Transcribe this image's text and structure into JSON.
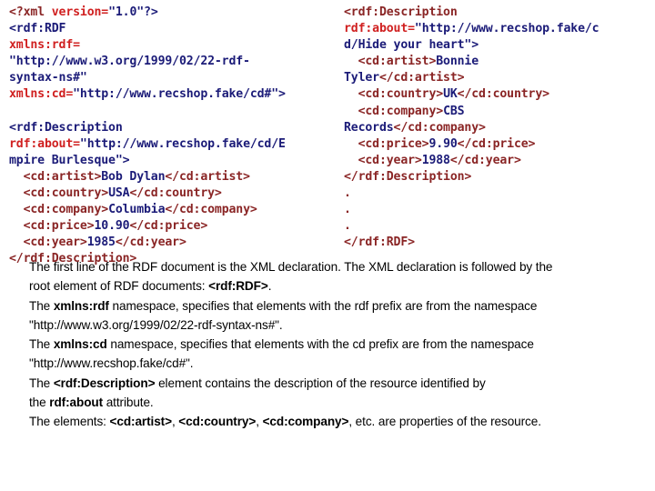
{
  "code": {
    "left_column": [
      {
        "id": "l1",
        "segments": [
          {
            "text": "<?xml ",
            "style": "c-decl"
          },
          {
            "text": "version=",
            "style": "c-attr"
          },
          {
            "text": "\"1.0\"?>",
            "style": "c-ns"
          }
        ]
      },
      {
        "id": "l2",
        "segments": [
          {
            "text": "<rdf:RDF",
            "style": "c-ns"
          }
        ]
      },
      {
        "id": "l3",
        "segments": [
          {
            "text": "xmlns:rdf=",
            "style": "c-attr"
          }
        ]
      },
      {
        "id": "l4",
        "segments": [
          {
            "text": "\"http://www.w3.org/1999/02/22-rdf-",
            "style": "c-ns"
          }
        ]
      },
      {
        "id": "l5",
        "segments": [
          {
            "text": "syntax-ns#\"",
            "style": "c-ns"
          }
        ]
      },
      {
        "id": "l6",
        "segments": [
          {
            "text": "xmlns:cd=",
            "style": "c-attr"
          },
          {
            "text": "\"http://www.recshop.fake/cd#\">",
            "style": "c-ns"
          }
        ]
      },
      {
        "id": "l7",
        "segments": [
          {
            "text": " ",
            "style": "c-ns"
          }
        ]
      },
      {
        "id": "l8",
        "segments": [
          {
            "text": "<rdf:Description",
            "style": "c-ns"
          }
        ]
      },
      {
        "id": "l9",
        "segments": [
          {
            "text": "rdf:about=",
            "style": "c-attr"
          },
          {
            "text": "\"http://www.recshop.fake/cd/E",
            "style": "c-ns"
          }
        ]
      },
      {
        "id": "l10",
        "segments": [
          {
            "text": "mpire Burlesque\">",
            "style": "c-ns"
          }
        ]
      },
      {
        "id": "l11",
        "segments": [
          {
            "text": "  <cd:artist>",
            "style": "c-tag"
          },
          {
            "text": "Bob Dylan",
            "style": "c-text"
          },
          {
            "text": "</cd:artist>",
            "style": "c-tag"
          }
        ]
      },
      {
        "id": "l12",
        "segments": [
          {
            "text": "  <cd:country>",
            "style": "c-tag"
          },
          {
            "text": "USA",
            "style": "c-text"
          },
          {
            "text": "</cd:country>",
            "style": "c-tag"
          }
        ]
      },
      {
        "id": "l13",
        "segments": [
          {
            "text": "  <cd:company>",
            "style": "c-tag"
          },
          {
            "text": "Columbia",
            "style": "c-text"
          },
          {
            "text": "</cd:company>",
            "style": "c-tag"
          }
        ]
      },
      {
        "id": "l14",
        "segments": [
          {
            "text": "  <cd:price>",
            "style": "c-tag"
          },
          {
            "text": "10.90",
            "style": "c-text"
          },
          {
            "text": "</cd:price>",
            "style": "c-tag"
          }
        ]
      },
      {
        "id": "l15",
        "segments": [
          {
            "text": "  <cd:year>",
            "style": "c-tag"
          },
          {
            "text": "1985",
            "style": "c-text"
          },
          {
            "text": "</cd:year>",
            "style": "c-tag"
          }
        ]
      },
      {
        "id": "l16",
        "segments": [
          {
            "text": "</rdf:Description>",
            "style": "c-tag"
          }
        ]
      }
    ],
    "right_column": [
      {
        "id": "r1",
        "segments": [
          {
            "text": "<rdf:Description",
            "style": "c-tag"
          }
        ]
      },
      {
        "id": "r2",
        "segments": [
          {
            "text": "rdf:about=",
            "style": "c-attr"
          },
          {
            "text": "\"http://www.recshop.fake/c",
            "style": "c-ns"
          }
        ]
      },
      {
        "id": "r3",
        "segments": [
          {
            "text": "d/Hide your heart\">",
            "style": "c-ns"
          }
        ]
      },
      {
        "id": "r4",
        "segments": [
          {
            "text": "  <cd:artist>",
            "style": "c-tag"
          },
          {
            "text": "Bonnie",
            "style": "c-text"
          }
        ]
      },
      {
        "id": "r5",
        "segments": [
          {
            "text": "Tyler",
            "style": "c-text"
          },
          {
            "text": "</cd:artist>",
            "style": "c-tag"
          }
        ]
      },
      {
        "id": "r6",
        "segments": [
          {
            "text": "  <cd:country>",
            "style": "c-tag"
          },
          {
            "text": "UK",
            "style": "c-text"
          },
          {
            "text": "</cd:country>",
            "style": "c-tag"
          }
        ]
      },
      {
        "id": "r7",
        "segments": [
          {
            "text": "  <cd:company>",
            "style": "c-tag"
          },
          {
            "text": "CBS",
            "style": "c-text"
          }
        ]
      },
      {
        "id": "r8",
        "segments": [
          {
            "text": "Records",
            "style": "c-text"
          },
          {
            "text": "</cd:company>",
            "style": "c-tag"
          }
        ]
      },
      {
        "id": "r9",
        "segments": [
          {
            "text": "  <cd:price>",
            "style": "c-tag"
          },
          {
            "text": "9.90",
            "style": "c-text"
          },
          {
            "text": "</cd:price>",
            "style": "c-tag"
          }
        ]
      },
      {
        "id": "r10",
        "segments": [
          {
            "text": "  <cd:year>",
            "style": "c-tag"
          },
          {
            "text": "1988",
            "style": "c-text"
          },
          {
            "text": "</cd:year>",
            "style": "c-tag"
          }
        ]
      },
      {
        "id": "r11",
        "segments": [
          {
            "text": "</rdf:Description>",
            "style": "c-tag"
          }
        ]
      },
      {
        "id": "r12",
        "segments": [
          {
            "text": ".",
            "style": "c-tag"
          }
        ]
      },
      {
        "id": "r13",
        "segments": [
          {
            "text": ".",
            "style": "c-tag"
          }
        ]
      },
      {
        "id": "r14",
        "segments": [
          {
            "text": ".",
            "style": "c-tag"
          }
        ]
      },
      {
        "id": "r15",
        "segments": [
          {
            "text": "</rdf:RDF>",
            "style": "c-tag"
          }
        ]
      }
    ]
  },
  "explanation": {
    "lines": [
      {
        "id": "e1",
        "parts": [
          {
            "text": "The first line of the RDF document is the XML declaration. The XML declaration is followed by the",
            "bold": false
          }
        ]
      },
      {
        "id": "e2",
        "parts": [
          {
            "text": "root element of RDF documents: ",
            "bold": false
          },
          {
            "text": "<rdf:RDF>",
            "bold": true
          },
          {
            "text": ".",
            "bold": false
          }
        ]
      },
      {
        "id": "e3",
        "parts": [
          {
            "text": "The ",
            "bold": false
          },
          {
            "text": "xmlns:rdf",
            "bold": true
          },
          {
            "text": " namespace, specifies that elements with the rdf prefix are from the namespace",
            "bold": false
          }
        ]
      },
      {
        "id": "e4",
        "parts": [
          {
            "text": "\"http://www.w3.org/1999/02/22-rdf-syntax-ns#\".",
            "bold": false
          }
        ]
      },
      {
        "id": "e5",
        "parts": [
          {
            "text": "The ",
            "bold": false
          },
          {
            "text": "xmlns:cd",
            "bold": true
          },
          {
            "text": " namespace, specifies that elements with the cd prefix are from the namespace",
            "bold": false
          }
        ]
      },
      {
        "id": "e6",
        "parts": [
          {
            "text": "\"http://www.recshop.fake/cd#\".",
            "bold": false
          }
        ]
      },
      {
        "id": "e7",
        "parts": [
          {
            "text": "The ",
            "bold": false
          },
          {
            "text": "<rdf:Description>",
            "bold": true
          },
          {
            "text": " element contains the description of the resource identified by",
            "bold": false
          }
        ]
      },
      {
        "id": "e8",
        "parts": [
          {
            "text": "the ",
            "bold": false
          },
          {
            "text": "rdf:about",
            "bold": true
          },
          {
            "text": " attribute.",
            "bold": false
          }
        ]
      },
      {
        "id": "e9",
        "parts": [
          {
            "text": "The elements: ",
            "bold": false
          },
          {
            "text": "<cd:artist>",
            "bold": true
          },
          {
            "text": ", ",
            "bold": false
          },
          {
            "text": "<cd:country>",
            "bold": true
          },
          {
            "text": ", ",
            "bold": false
          },
          {
            "text": "<cd:company>",
            "bold": true
          },
          {
            "text": ", etc. are properties of the resource.",
            "bold": false
          }
        ]
      }
    ]
  },
  "colors": {
    "background": "#ffffff",
    "tag": "#8a2525",
    "namespace": "#1b1b78",
    "attribute": "#d02020",
    "text_content": "#1b1b78",
    "explanation_text": "#000000"
  }
}
